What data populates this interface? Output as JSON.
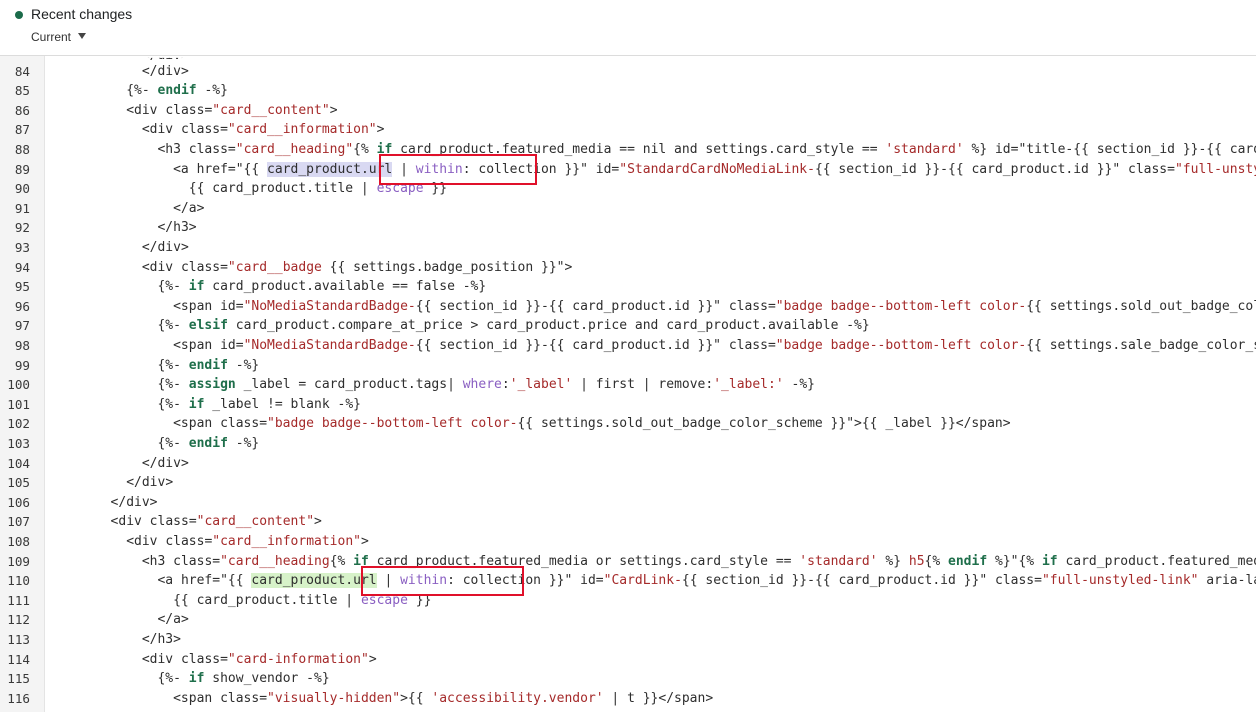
{
  "header": {
    "title": "Recent changes",
    "version_label": "Current",
    "colors": {
      "status_dot": "#1b6b4a",
      "highlight_box": "#e0102a"
    }
  },
  "editor": {
    "partial_top_line": "</div>",
    "lines": [
      {
        "n": "84",
        "indent": 6,
        "parts": [
          [
            "t",
            "</div>"
          ]
        ]
      },
      {
        "n": "85",
        "indent": 5,
        "parts": [
          [
            "t",
            "{%- "
          ],
          [
            "k",
            "endif"
          ],
          [
            "t",
            " -%}"
          ]
        ]
      },
      {
        "n": "86",
        "indent": 5,
        "parts": [
          [
            "t",
            "<div class="
          ],
          [
            "s",
            "\"card__content\""
          ],
          [
            "t",
            ">"
          ]
        ]
      },
      {
        "n": "87",
        "indent": 6,
        "parts": [
          [
            "t",
            "<div class="
          ],
          [
            "s",
            "\"card__information\""
          ],
          [
            "t",
            ">"
          ]
        ]
      },
      {
        "n": "88",
        "indent": 7,
        "parts": [
          [
            "t",
            "<h3 class="
          ],
          [
            "s",
            "\"card__heading\""
          ],
          [
            "t",
            "{% "
          ],
          [
            "k",
            "if"
          ],
          [
            "t",
            " card_product.featured_media == nil and settings.card_style == "
          ],
          [
            "s",
            "'standard'"
          ],
          [
            "t",
            " %} id=\"title-{{ section_id }}-{{ card_pro"
          ]
        ]
      },
      {
        "n": "89",
        "indent": 8,
        "parts": [
          [
            "t",
            "<a href=\"{{ "
          ],
          [
            "h1",
            "card_product.url"
          ],
          [
            "t",
            " | "
          ],
          [
            "f",
            "within"
          ],
          [
            "t",
            ": collection }}\" id="
          ],
          [
            "s",
            "\"StandardCardNoMediaLink-"
          ],
          [
            "t",
            "{{ section_id }}-{{ card_product.id }}\" class="
          ],
          [
            "s",
            "\"full-unstyled-"
          ]
        ]
      },
      {
        "n": "90",
        "indent": 9,
        "parts": [
          [
            "t",
            "{{ card_product.title | "
          ],
          [
            "f",
            "escape"
          ],
          [
            "t",
            " }}"
          ]
        ]
      },
      {
        "n": "91",
        "indent": 8,
        "parts": [
          [
            "t",
            "</a>"
          ]
        ]
      },
      {
        "n": "92",
        "indent": 7,
        "parts": [
          [
            "t",
            "</h3>"
          ]
        ]
      },
      {
        "n": "93",
        "indent": 6,
        "parts": [
          [
            "t",
            "</div>"
          ]
        ]
      },
      {
        "n": "94",
        "indent": 6,
        "parts": [
          [
            "t",
            "<div class="
          ],
          [
            "s",
            "\"card__badge "
          ],
          [
            "t",
            "{{ settings.badge_position }}\">"
          ]
        ]
      },
      {
        "n": "95",
        "indent": 7,
        "parts": [
          [
            "t",
            "{%- "
          ],
          [
            "k",
            "if"
          ],
          [
            "t",
            " card_product.available == false -%}"
          ]
        ]
      },
      {
        "n": "96",
        "indent": 8,
        "parts": [
          [
            "t",
            "<span id="
          ],
          [
            "s",
            "\"NoMediaStandardBadge-"
          ],
          [
            "t",
            "{{ section_id }}-{{ card_product.id }}\" class="
          ],
          [
            "s",
            "\"badge badge--bottom-left color-"
          ],
          [
            "t",
            "{{ settings.sold_out_badge_color_s"
          ]
        ]
      },
      {
        "n": "97",
        "indent": 7,
        "parts": [
          [
            "t",
            "{%- "
          ],
          [
            "k",
            "elsif"
          ],
          [
            "t",
            " card_product.compare_at_price > card_product.price and card_product.available -%}"
          ]
        ]
      },
      {
        "n": "98",
        "indent": 8,
        "parts": [
          [
            "t",
            "<span id="
          ],
          [
            "s",
            "\"NoMediaStandardBadge-"
          ],
          [
            "t",
            "{{ section_id }}-{{ card_product.id }}\" class="
          ],
          [
            "s",
            "\"badge badge--bottom-left color-"
          ],
          [
            "t",
            "{{ settings.sale_badge_color_schem"
          ]
        ]
      },
      {
        "n": "99",
        "indent": 7,
        "parts": [
          [
            "t",
            "{%- "
          ],
          [
            "k",
            "endif"
          ],
          [
            "t",
            " -%}"
          ]
        ]
      },
      {
        "n": "100",
        "indent": 7,
        "parts": [
          [
            "t",
            "{%- "
          ],
          [
            "k",
            "assign"
          ],
          [
            "t",
            " _label = card_product.tags| "
          ],
          [
            "f",
            "where"
          ],
          [
            "t",
            ":"
          ],
          [
            "s",
            "'_label'"
          ],
          [
            "t",
            " | first | remove:"
          ],
          [
            "s",
            "'_label:'"
          ],
          [
            "t",
            " -%}"
          ]
        ]
      },
      {
        "n": "101",
        "indent": 7,
        "parts": [
          [
            "t",
            "{%- "
          ],
          [
            "k",
            "if"
          ],
          [
            "t",
            " _label != blank -%}"
          ]
        ]
      },
      {
        "n": "102",
        "indent": 8,
        "parts": [
          [
            "t",
            "<span class="
          ],
          [
            "s",
            "\"badge badge--bottom-left color-"
          ],
          [
            "t",
            "{{ settings.sold_out_badge_color_scheme }}\">{{ _label }}</span>"
          ]
        ]
      },
      {
        "n": "103",
        "indent": 7,
        "parts": [
          [
            "t",
            "{%- "
          ],
          [
            "k",
            "endif"
          ],
          [
            "t",
            " -%}"
          ]
        ]
      },
      {
        "n": "104",
        "indent": 6,
        "parts": [
          [
            "t",
            "</div>"
          ]
        ]
      },
      {
        "n": "105",
        "indent": 5,
        "parts": [
          [
            "t",
            "</div>"
          ]
        ]
      },
      {
        "n": "106",
        "indent": 4,
        "parts": [
          [
            "t",
            "</div>"
          ]
        ]
      },
      {
        "n": "107",
        "indent": 4,
        "parts": [
          [
            "t",
            "<div class="
          ],
          [
            "s",
            "\"card__content\""
          ],
          [
            "t",
            ">"
          ]
        ]
      },
      {
        "n": "108",
        "indent": 5,
        "parts": [
          [
            "t",
            "<div class="
          ],
          [
            "s",
            "\"card__information\""
          ],
          [
            "t",
            ">"
          ]
        ]
      },
      {
        "n": "109",
        "indent": 6,
        "parts": [
          [
            "t",
            "<h3 class="
          ],
          [
            "s",
            "\"card__heading"
          ],
          [
            "t",
            "{% "
          ],
          [
            "k",
            "if"
          ],
          [
            "t",
            " card_product.featured_media or settings.card_style == "
          ],
          [
            "s",
            "'standard'"
          ],
          [
            "t",
            " %} "
          ],
          [
            "s",
            "h5"
          ],
          [
            "t",
            "{% "
          ],
          [
            "k",
            "endif"
          ],
          [
            "t",
            " %}\"{% "
          ],
          [
            "k",
            "if"
          ],
          [
            "t",
            " card_product.featured_media o"
          ]
        ]
      },
      {
        "n": "110",
        "indent": 7,
        "parts": [
          [
            "t",
            "<a href=\"{{ "
          ],
          [
            "h2",
            "card_product.url"
          ],
          [
            "t",
            " | "
          ],
          [
            "f",
            "within"
          ],
          [
            "t",
            ": collection }}\" id="
          ],
          [
            "s",
            "\"CardLink-"
          ],
          [
            "t",
            "{{ section_id }}-{{ card_product.id }}\" class="
          ],
          [
            "s",
            "\"full-unstyled-link\""
          ],
          [
            "t",
            " aria-labell"
          ]
        ]
      },
      {
        "n": "111",
        "indent": 8,
        "parts": [
          [
            "t",
            "{{ card_product.title | "
          ],
          [
            "f",
            "escape"
          ],
          [
            "t",
            " }}"
          ]
        ]
      },
      {
        "n": "112",
        "indent": 7,
        "parts": [
          [
            "t",
            "</a>"
          ]
        ]
      },
      {
        "n": "113",
        "indent": 6,
        "parts": [
          [
            "t",
            "</h3>"
          ]
        ]
      },
      {
        "n": "114",
        "indent": 6,
        "parts": [
          [
            "t",
            "<div class="
          ],
          [
            "s",
            "\"card-information\""
          ],
          [
            "t",
            ">"
          ]
        ]
      },
      {
        "n": "115",
        "indent": 7,
        "parts": [
          [
            "t",
            "{%- "
          ],
          [
            "k",
            "if"
          ],
          [
            "t",
            " show_vendor -%}"
          ]
        ]
      },
      {
        "n": "116",
        "indent": 8,
        "parts": [
          [
            "t",
            "<span class="
          ],
          [
            "s",
            "\"visually-hidden\""
          ],
          [
            "t",
            ">{{ "
          ],
          [
            "s",
            "'accessibility.vendor'"
          ],
          [
            "t",
            " | t }}</span>"
          ]
        ]
      }
    ]
  }
}
